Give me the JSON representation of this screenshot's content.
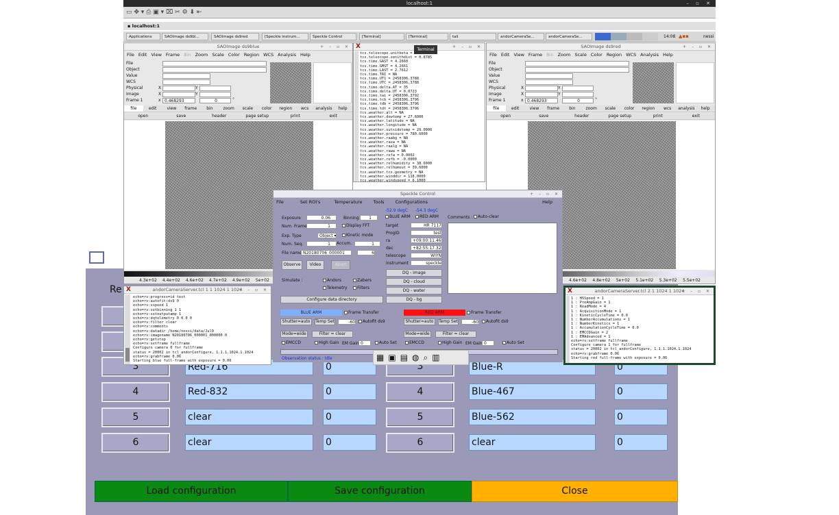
{
  "topbar": {
    "title": "localhost:1"
  },
  "tab_label": "localhost:1",
  "taskbar": {
    "items": [
      "Applications",
      "SAOImage ds9bl...",
      "SAOImage ds9red",
      "[Speckle instrum...",
      "Speckle Control",
      "[Terminal]",
      "[Terminal]",
      "tail",
      "andorCameraSe...",
      "andorCameraSe..."
    ],
    "time": "14:08",
    "user": "nessi"
  },
  "ds9_blue": {
    "title": "SAOImage ds9blue",
    "menu": [
      "File",
      "Edit",
      "View",
      "Frame",
      "Bin",
      "Zoom",
      "Scale",
      "Color",
      "Region",
      "WCS",
      "Analysis",
      "Help"
    ],
    "info_labels": [
      "File",
      "Object",
      "Value",
      "WCS",
      "Physical",
      "Image",
      "Frame 1"
    ],
    "xy": [
      "X",
      "Y",
      "X",
      "Y",
      "x"
    ],
    "zoom_value": "0.468293",
    "angle_value": "0",
    "degree": "°",
    "buttons1": [
      "file",
      "edit",
      "view",
      "frame",
      "bin",
      "zoom",
      "scale",
      "color",
      "region",
      "wcs",
      "analysis",
      "help"
    ],
    "buttons2": [
      "open",
      "save",
      "header",
      "page setup",
      "print",
      "exit"
    ],
    "ticks": [
      "4.3e+02",
      "4.4e+02",
      "4.6e+02",
      "4.7e+02",
      "4.9e+02",
      "5e+02"
    ]
  },
  "ds9_red": {
    "title": "SAOImage ds9red",
    "menu": [
      "File",
      "Edit",
      "View",
      "Frame",
      "Bin",
      "Zoom",
      "Scale",
      "Color",
      "Region",
      "WCS",
      "Analysis",
      "Help"
    ],
    "info_labels": [
      "File",
      "Object",
      "Value",
      "WCS",
      "Physical",
      "Image",
      "Frame 1"
    ],
    "xy": [
      "X",
      "Y",
      "X",
      "Y",
      "x"
    ],
    "zoom_value": "0.468293",
    "angle_value": "0",
    "degree": "°",
    "buttons1": [
      "file",
      "edit",
      "view",
      "frame",
      "bin",
      "zoom",
      "scale",
      "color",
      "region",
      "wcs",
      "analysis",
      "help"
    ],
    "buttons2": [
      "open",
      "save",
      "header",
      "page setup",
      "print",
      "exit"
    ],
    "ticks": [
      "4.6e+02",
      "4.8e+02",
      "5e+02",
      "5.1e+02",
      "5.3e+02",
      "5.5e+02"
    ]
  },
  "tail": {
    "title": "tail",
    "tooltip": "Terminal",
    "text": "tcs.telescope.unitbeta = 0.0000\ntcs.telescope.zenithdist = 0.8785\ntcs.time.GAST = 4.2660\ntcs.time.GMST = 4.2661\ntcs.time.LAST = 2.7612\ntcs.time.TAI = NA\ntcs.time.UT1 = 2458306.3788\ntcs.time.UTC = 2458306.3788\ntcs.time.delta.AT = 35\ntcs.time.delta.UT = 0.0723\ntcs.time.tai = 2458306.3792\ntcs.time.tcb = 2458306.3796\ntcs.time.tdb = 2458306.3796\ntcs.time.tdt = 2458306.3796\ntcs.weather.alt = NA\ntcs.weather.dewtemp = 27.6000\ntcs.weather.latitude = NA\ntcs.weather.longitude = NA\ntcs.weather.outsidetemp = 29.0000\ntcs.weather.pressure = 780.6000\ntcs.weather.raabg = NA\ntcs.weather.rasw = NA\ntcs.weather.raalg = NA\ntcs.weather.raww = NA\ntcs.weather.refa = 0.0002\ntcs.weather.refb = -0.0000\ntcs.weather.relhumidity = 38.6000\ntcs.weather.relhumout = 39.6000\ntcs.weather.tcs.geometry = NA\ntcs.weather.winddir = 118.0000\ntcs.weather.windspeed = 6.1000\ntimestamp = 1530911127/2018-07-06/14:05:27.000/MST/"
  },
  "speckle": {
    "title": "Speckle Control",
    "menu": [
      "File",
      "Set ROI's",
      "Temperature",
      "Tools",
      "Configurations",
      "Help"
    ],
    "temp_blue": "-52.9 degC",
    "temp_red": "-54.3 degC",
    "blue_arm_label": "BLUE ARM",
    "red_arm_label": "RED ARM",
    "comments_label": "Comments :",
    "autoclear_label": "Auto-clear",
    "exposure_label": "Exposure",
    "exposure_value": "0.06",
    "binning_label": "Binning",
    "binning_value": "1",
    "numframes_label": "Num. Frames",
    "numframes_value": "1",
    "displayfft_label": "Display FFT",
    "exptype_label": "Exp. Type",
    "exptype_value": "Object",
    "kinetic_label": "Kinetic mode",
    "numseq_label": "Num. Seq.",
    "numseq_value": "1",
    "accum_label": "Accum.",
    "accum_value": "1",
    "filename_label": "File name :",
    "filename_value": "N20180706_000001",
    "filename_num": "6",
    "observe_btn": "Observe",
    "video_btn": "Video",
    "abort_btn": "Abort",
    "target_label": "target",
    "target_value": "HR 7117",
    "progid_label": "ProgID",
    "progid_value": "test",
    "ra_label": "ra",
    "ra_value": "+09:00:11.469",
    "dec_label": "dec",
    "dec_value": "+82:55:17.328",
    "telescope_label": "telescope",
    "telescope_value": "WIYN",
    "instrument_label": "instrument",
    "instrument_value": "speckle",
    "simulate_label": "Simulate :",
    "andors_label": "Andors",
    "zabers_label": "Zabers",
    "telemetry_label": "Telemetry",
    "filters_label": "Filters",
    "configdir_btn": "Configure data directory",
    "dq_buttons": [
      "DQ - image",
      "DQ - cloud",
      "DQ - water",
      "DQ - bg"
    ],
    "frame_transfer": "Frame Transfer",
    "shutter_auto": "Shutter=auto",
    "temp_set": "Temp Set",
    "temp_set_value": "-60",
    "autofit_ds9": "Autofit ds9",
    "mode_wide": "Mode=wide",
    "filter_clear": "Filter = clear",
    "emccd": "EMCCD",
    "high_gain": "High Gain",
    "em_gain": "EM Gain",
    "em_gain_value": "0",
    "auto_set": "Auto Set",
    "status": "Observation status : Idle"
  },
  "andor_blue": {
    "title": "andorCameraServer.tcl 1 1 1024 1 1024",
    "text": "echo=rv:progress=id test\necho=rv:autofit:ds9 0\necho=rv:vspeed 1\necho=rv:setbinning 1 1\necho=rv:setoutputamp 1\necho=rv:dqtelemetry 0 0 0 0\necho=rv:filter clear\necho=rv:comments\necho=rv:datadir /home/nessi/data/Jul9\necho=rv:imagename N20180706_000001_000000 0\necho=rv:getstep\necho=rv:setframe fullframe\nConfigure camera 0 for fullframe\nstatus = 20002 in tcl_andorConfigure, 1.1.1.1024.1.1024\necho=rv:grabframe 0.06\nStarting blue full-frame with exposure = 0.06"
  },
  "andor_red": {
    "title": "andorCameraServer.tcl 2 1 1024 1 1024",
    "text": "1 : HSSpeed = 1\n1 : PreAmpGain = 1\n1 : ReadMode = 4\n1 : AcquisitionMode = 1\n1 : KineticCycleTime = 0.0\n1 : NumberAccumulations = 1\n1 : NumberKinetics = 1\n1 : AccumulationCycleTime = 0.0\n1 : EMCCDGain = 2\n1 : EMAdvanced = 1\necho=rv:setframe fullframe\nConfigure camera 1 for fullframe\nstatus = 20002 in tcl_andorConfigure, 1.1.1.1024.1.1024\necho=rv:grabframe 0.06\nStarting red full-frame with exposure = 0.06"
  },
  "filters": {
    "header_partial": "Re",
    "rows": [
      {
        "left_num": "3",
        "left_name": "Red-716",
        "left_val": "0",
        "right_num": "3",
        "right_name": "Blue-R",
        "right_val": "0"
      },
      {
        "left_num": "4",
        "left_name": "Red-832",
        "left_val": "0",
        "right_num": "4",
        "right_name": "Blue-467",
        "right_val": "0"
      },
      {
        "left_num": "5",
        "left_name": "clear",
        "left_val": "0",
        "right_num": "5",
        "right_name": "Blue-562",
        "right_val": "0"
      },
      {
        "left_num": "6",
        "left_name": "clear",
        "left_val": "0",
        "right_num": "6",
        "right_name": "clear",
        "right_val": "0"
      }
    ],
    "load_btn": "Load configuration",
    "save_btn": "Save configuration",
    "close_btn": "Close"
  },
  "colors": {
    "green": "#0b8a12",
    "orange": "#ffb000",
    "panel": "#9a9ab8",
    "field": "#b8d8ff",
    "red_arm": "#ff1010",
    "blue_arm": "#7fb0ff"
  }
}
